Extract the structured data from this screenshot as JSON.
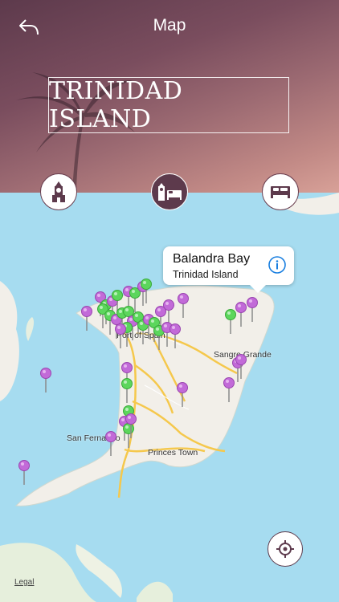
{
  "header": {
    "title": "Map",
    "back_icon": "back-arrow-icon"
  },
  "banner": {
    "title": "TRINIDAD ISLAND"
  },
  "categories": [
    {
      "name": "landmark",
      "icon": "clock-tower-icon",
      "active": false
    },
    {
      "name": "landmark-and-hotel",
      "icon": "tower-and-bed-icon",
      "active": true
    },
    {
      "name": "hotel",
      "icon": "bed-icon",
      "active": false
    }
  ],
  "callout": {
    "title": "Balandra Bay",
    "subtitle": "Trinidad Island",
    "icon": "info-icon"
  },
  "towns": [
    "Port of Spain",
    "Sangre Grande",
    "San Fernando",
    "Princes Town"
  ],
  "map": {
    "legal_label": "Legal",
    "locate_icon": "crosshair-locate-icon"
  },
  "colors": {
    "header": "#5d3a4c",
    "water": "#a6dcf0",
    "land": "#f2efe9",
    "pin_purple": "#c26ad8",
    "pin_green": "#5cd65c",
    "road": "#f5c84c"
  }
}
